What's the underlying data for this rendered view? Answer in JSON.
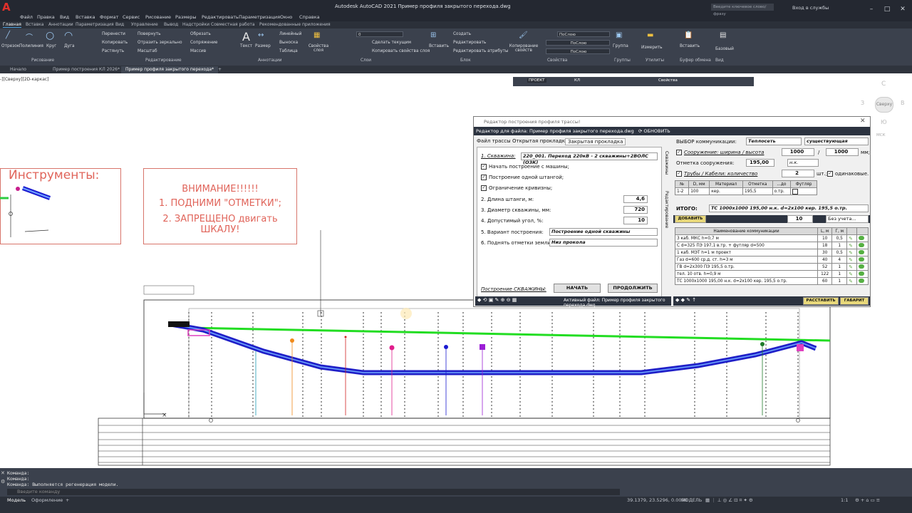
{
  "window": {
    "title": "Autodesk AutoCAD 2021   Пример профиля закрытого перехода.dwg",
    "search_placeholder": "Введите ключевое слово/фразу",
    "login": "Вход в службы"
  },
  "menu": [
    "Файл",
    "Правка",
    "Вид",
    "Вставка",
    "Формат",
    "Сервис",
    "Рисование",
    "Размеры",
    "Редактировать",
    "Параметризация",
    "Окно",
    "Справка"
  ],
  "ribbon_tabs": [
    "Главная",
    "Вставка",
    "Аннотации",
    "Параметризация",
    "Вид",
    "Управление",
    "Вывод",
    "Надстройки",
    "Совместная работа",
    "Рекомендованные приложения"
  ],
  "ribbon": {
    "draw": [
      "Отрезок",
      "Полилиния",
      "Круг",
      "Дуга"
    ],
    "modify": [
      "Перенести",
      "Повернуть",
      "Обрезать",
      "Копировать",
      "Отразить зеркально",
      "Сопряжение",
      "Растянуть",
      "Масштаб",
      "Массив"
    ],
    "annot": [
      "Текст",
      "Размер",
      "Линейный",
      "Выноска",
      "Таблица"
    ],
    "layers": [
      "Свойства слоя",
      "Сделать текущим",
      "Копировать свойства слоя"
    ],
    "layer_value": "0",
    "block": [
      "Вставить",
      "Создать",
      "Редактировать",
      "Редактировать атрибуты"
    ],
    "props": [
      "Копирование свойств",
      "ПоСлою",
      "ПоСлою",
      "ПоСлою"
    ],
    "right": [
      "Группа",
      "Измерить",
      "Вставить",
      "Базовый"
    ],
    "groups": [
      "Рисование",
      "Редактирование",
      "Аннотации",
      "Слои",
      "Блок",
      "Свойства",
      "Группы",
      "Утилиты",
      "Буфер обмена",
      "Вид"
    ]
  },
  "doc_tabs": [
    "Начало",
    "Пример построения КЛ 2026*",
    "Пример профиля закрытого перехода*"
  ],
  "viewport_label": "-][Сверху][2D-каркас]",
  "viewcube": {
    "top": "С",
    "face": "Сверху",
    "left": "З",
    "right": "В",
    "bottom": "Ю",
    "ucs": "МСК"
  },
  "float_toolbar": {
    "mode": "ПРОЕКТ",
    "props": "Свойства",
    "kl": "КЛ"
  },
  "notes": {
    "tools_title": "Инструменты:",
    "warn1": "ВНИМАНИЕ!!!!!!",
    "warn2": "1. ПОДНИМИ \"ОТМЕТКИ\";",
    "warn3": "2. ЗАПРЕЩЕНО двигать ШКАЛУ!"
  },
  "dialog": {
    "title": "Редактор построения профиля трассы!",
    "file_bar": "Редактор для файла: Пример профиля закрытого перехода.dwg",
    "refresh": "ОБНОВИТЬ",
    "tabs": [
      "Файл трассы",
      "Открытая прокладка",
      "Закрытая прокладка"
    ],
    "side_tabs": [
      "Скважины",
      "Редактирование"
    ],
    "well_label": "1. Скважина:",
    "well_value": "220_001. Переход 220кВ - 2 скважины+2ВОЛС (ОЗК)",
    "checks": [
      "Начать построение с машины;",
      "Построение одной штангой;",
      "Ограничение кривизны;"
    ],
    "param2": "2. Длина штанги, м:",
    "param2_val": "4,6",
    "param3": "3. Диаметр скважины, мм:",
    "param3_val": "720",
    "param4": "4. Допустимый угол, %:",
    "param4_val": "10",
    "param5": "5. Вариант построения:",
    "param5_val": "Построение одной скважины",
    "param6": "6. Поднять отметки земли:",
    "param6_val": "Низ прокола",
    "build_label": "Построение СКВАЖИНЫ:",
    "start_btn": "НАЧАТЬ",
    "continue_btn": "ПРОДОЛЖИТЬ",
    "active_file": "Активный файл: Пример профиля закрытого перехода.dwg",
    "comm_label": "ВЫБОР коммуникации:",
    "comm_value": "Теплосеть",
    "comm_state": "существующая",
    "struct_label": "Сооружение: ширина / высота",
    "struct_w": "1000",
    "struct_slash": "/",
    "struct_h": "1000",
    "struct_unit": "мм;",
    "elev_label": "Отметка сооружения:",
    "elev_val": "195,00",
    "elev_ref": "н.к.",
    "pipes_label": "Трубы / Кабели: количество",
    "pipes_val": "2",
    "pipes_unit": "шт.;",
    "same_label": "одинаковые.",
    "pipe_headers": [
      "№",
      "D, мм",
      "Материал",
      "Отметка",
      "...до",
      "Футляр"
    ],
    "pipe_row": [
      "1-2",
      "100",
      "кер.",
      "195,5",
      "о.тр."
    ],
    "total_label": "ИТОГО:",
    "total_val": "ТС 1000x1000 195,00 н.к.  d=2х100 кер. 195,5 о.тр.",
    "add_btn": "ДОБАВИТЬ",
    "add_val": "10",
    "add_dd": "Без учета...",
    "list_headers": [
      "Наименование коммуникации",
      "L, м",
      "Г, м"
    ],
    "list": [
      [
        "3 каб. МКС h=0,7 м",
        "10",
        "0,5"
      ],
      [
        "С d=325 ПЭ 197,1 в.тр. + футляр d=500",
        "18",
        "1"
      ],
      [
        "1 каб. МЭТ h=1 м проект",
        "30",
        "0,5"
      ],
      [
        "Газ d=600 ср.д. ст. h=3 м",
        "40",
        "4"
      ],
      [
        "ГВ d=2х300 ПЭ 195,5 о.тр.",
        "52",
        "1"
      ],
      [
        "тел. 10 отв. h=0,9 м",
        "122",
        "1"
      ],
      [
        "ТС 1000х1000 195,00 н.к.  d=2х100 кер. 195,5 о.тр.",
        "60",
        "1"
      ]
    ],
    "arrange_btn": "РАССТАВИТЬ",
    "gabarit_btn": "ГАБАРИТ"
  },
  "command": {
    "lines": [
      "Команда:",
      "Команда:",
      "Команда: Выполняется регенерация модели."
    ],
    "placeholder": "Введите команду"
  },
  "status": {
    "tabs": [
      "Модель",
      "Оформление"
    ],
    "coords": "39.1379, 23.5296, 0.0000",
    "mode": "МОДЕЛЬ",
    "scale": "1:1"
  }
}
